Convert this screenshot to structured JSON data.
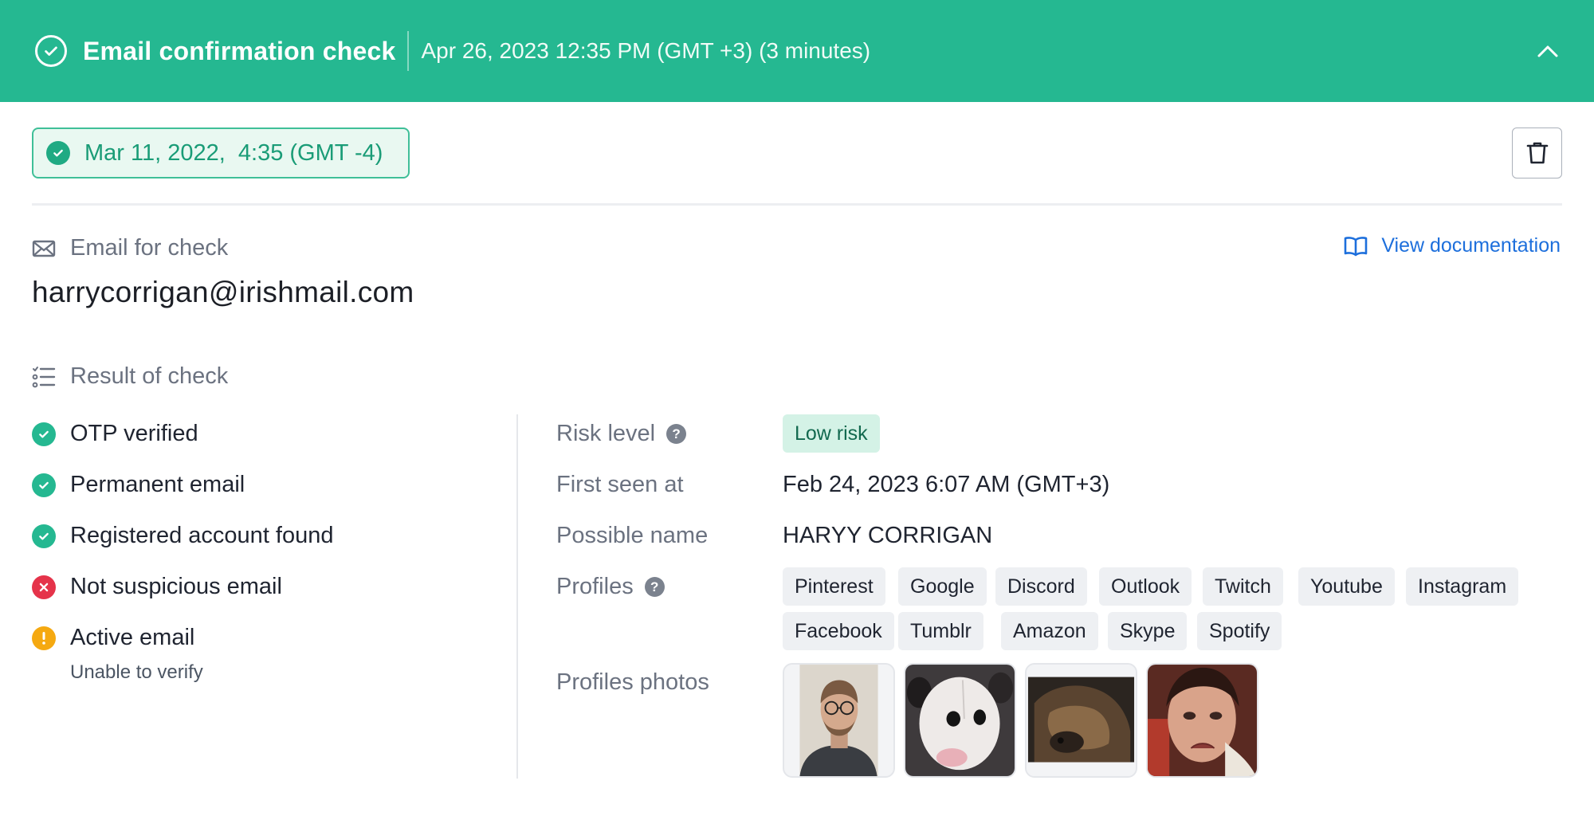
{
  "header": {
    "title": "Email confirmation check",
    "timestamp": "Apr 26, 2023 12:35 PM (GMT +3) (3 minutes)",
    "accent_color": "#25b891"
  },
  "date_chip": {
    "label": "Mar 11, 2022,  4:35 (GMT -4)"
  },
  "email_section": {
    "label": "Email for check",
    "value": "harrycorrigan@irishmail.com",
    "doc_link": "View documentation"
  },
  "result_section": {
    "label": "Result of check"
  },
  "checks": [
    {
      "label": "OTP verified",
      "status": "ok"
    },
    {
      "label": "Permanent email",
      "status": "ok"
    },
    {
      "label": "Registered account found",
      "status": "ok"
    },
    {
      "label": "Not suspicious email",
      "status": "bad"
    },
    {
      "label": "Active email",
      "status": "warn",
      "note": "Unable to verify"
    }
  ],
  "details": {
    "risk_level": {
      "label": "Risk level",
      "value": "Low risk"
    },
    "first_seen": {
      "label": "First seen at",
      "value": "Feb 24, 2023 6:07 AM (GMT+3)"
    },
    "possible_name": {
      "label": "Possible name",
      "value": "HARYY CORRIGAN"
    },
    "profiles": {
      "label": "Profiles",
      "items": [
        "Pinterest",
        "Google",
        "Discord",
        "Outlook",
        "Twitch",
        "Youtube",
        "Instagram",
        "Facebook",
        "Tumblr",
        "Amazon",
        "Skype",
        "Spotify"
      ]
    },
    "profile_photos": {
      "label": "Profiles photos"
    }
  }
}
